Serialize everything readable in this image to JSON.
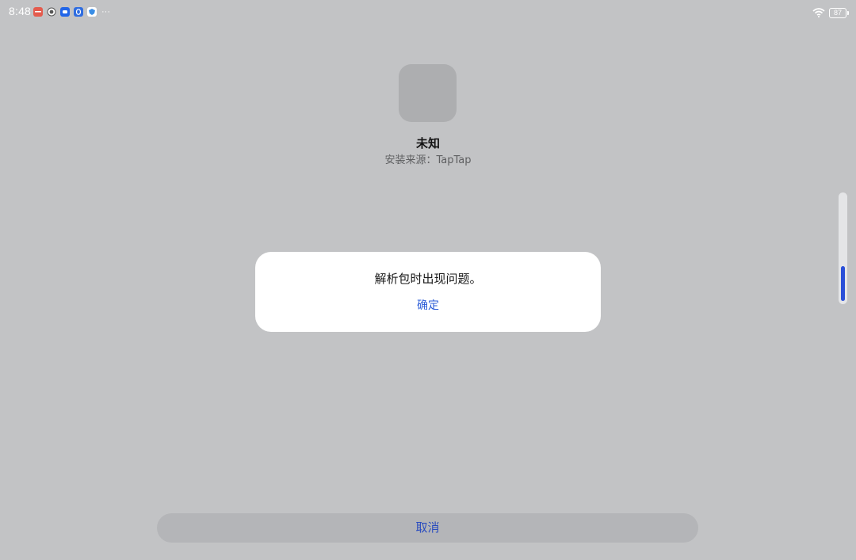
{
  "status_bar": {
    "time": "8:48",
    "battery": "87",
    "notification_icons": [
      {
        "name": "red-app-icon",
        "color": "#e45b4d"
      },
      {
        "name": "circle-app-icon",
        "color": "#6a6a6a"
      },
      {
        "name": "blue-chat-icon",
        "color": "#2266e8"
      },
      {
        "name": "blue-shield-icon",
        "color": "#2f6de0"
      },
      {
        "name": "lightblue-app-icon",
        "color": "#3a8ee6"
      }
    ],
    "more_indicator": "···"
  },
  "app": {
    "name": "未知",
    "install_source": "安装来源：TapTap"
  },
  "dialog": {
    "message": "解析包时出现问题。",
    "confirm_label": "确定"
  },
  "footer": {
    "cancel_label": "取消"
  },
  "colors": {
    "background": "#c2c3c5",
    "accent": "#2a5bd7"
  }
}
